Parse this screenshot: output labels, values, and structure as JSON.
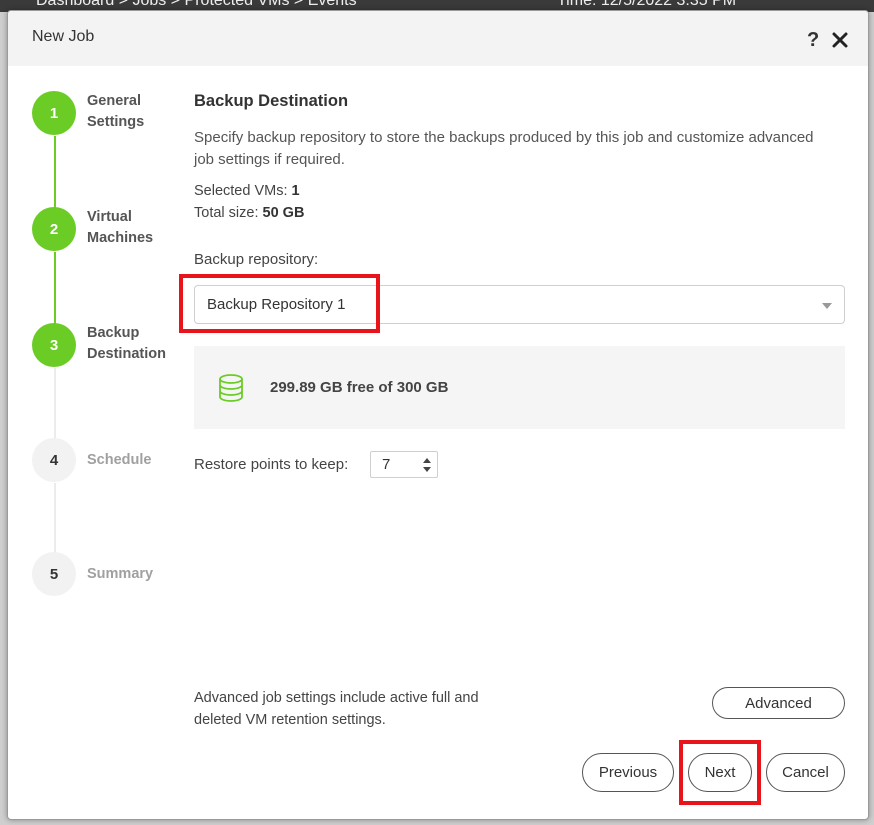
{
  "background": {
    "breadcrumb": "Dashboard > Jobs > Protected VMs > Events",
    "time": "Time: 12/5/2022 3:35 PM"
  },
  "dialog": {
    "title": "New Job",
    "help_label": "?"
  },
  "steps": [
    {
      "number": "1",
      "label": "General Settings",
      "state": "done"
    },
    {
      "number": "2",
      "label": "Virtual Machines",
      "state": "done"
    },
    {
      "number": "3",
      "label": "Backup Destination",
      "state": "current"
    },
    {
      "number": "4",
      "label": "Schedule",
      "state": "todo"
    },
    {
      "number": "5",
      "label": "Summary",
      "state": "todo"
    }
  ],
  "main": {
    "title": "Backup Destination",
    "description": "Specify backup repository to store the backups produced by this job and customize advanced job settings if required.",
    "selected_vms_label": "Selected VMs:",
    "selected_vms_value": "1",
    "total_size_label": "Total size:",
    "total_size_value": "50 GB",
    "repository_label": "Backup repository:",
    "repository_value": "Backup Repository 1",
    "repository_free": "299.89 GB free of 300 GB",
    "restore_points_label": "Restore points to keep:",
    "restore_points_value": "7",
    "advanced_note": "Advanced job settings include active full and deleted VM retention settings."
  },
  "buttons": {
    "advanced": "Advanced",
    "previous": "Previous",
    "next": "Next",
    "cancel": "Cancel"
  },
  "colors": {
    "step_done": "#6ccc26",
    "highlight": "#e8141b"
  }
}
